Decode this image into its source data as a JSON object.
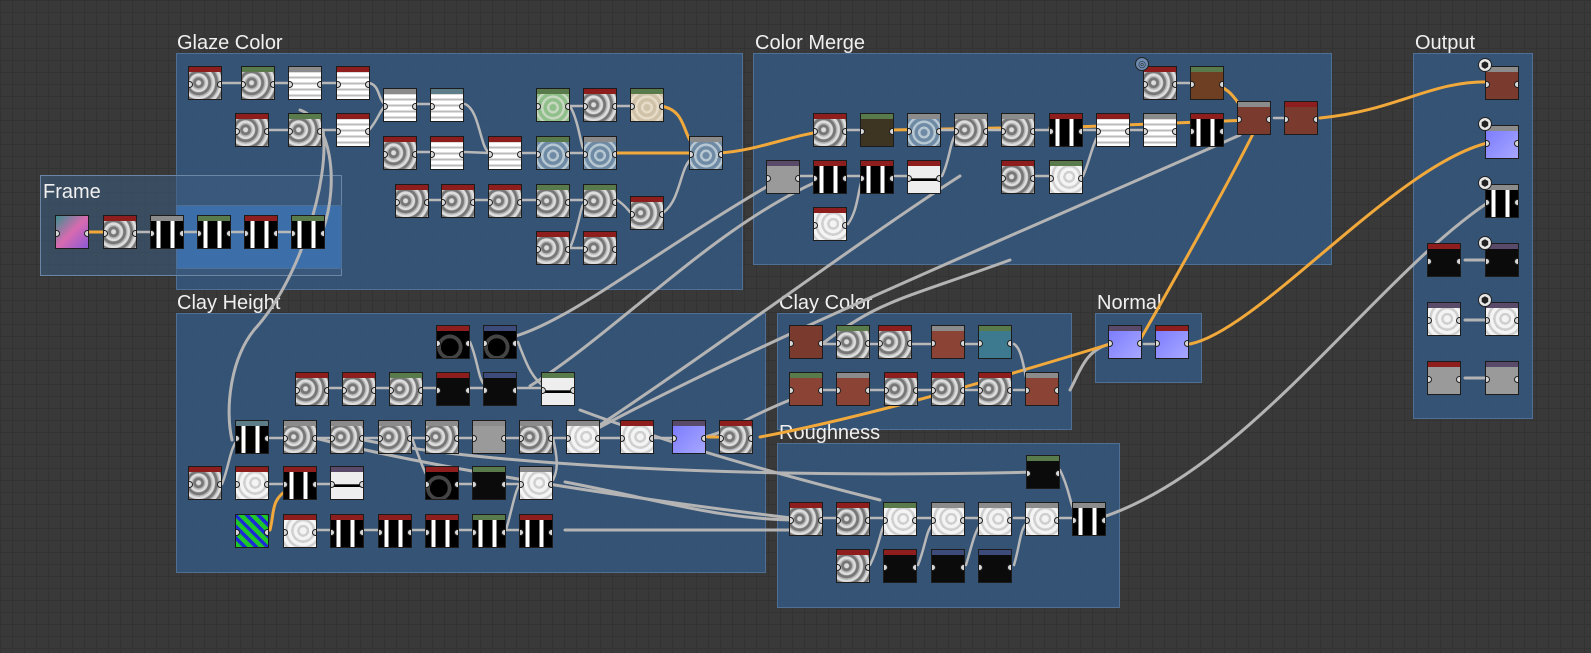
{
  "frames": {
    "glaze_color": "Glaze Color",
    "color_merge": "Color Merge",
    "output": "Output",
    "frame": "Frame",
    "clay_height": "Clay Height",
    "clay_color": "Clay Color",
    "normal": "Normal",
    "roughness": "Roughness"
  },
  "colors": {
    "canvas": "#393939",
    "frame_fill": "#34567d",
    "wire_orange": "#f2a93b",
    "wire_gray": "#b4b4b4",
    "header_red": "#8e1d1d",
    "header_green": "#597a4b",
    "header_gray": "#8b8b8b",
    "header_purple": "#5a4a6a",
    "header_blue": "#3c4b7a"
  },
  "output_icons": [
    "cube-icon",
    "cube-icon",
    "cube-icon",
    "cube-icon",
    "cube-icon"
  ]
}
